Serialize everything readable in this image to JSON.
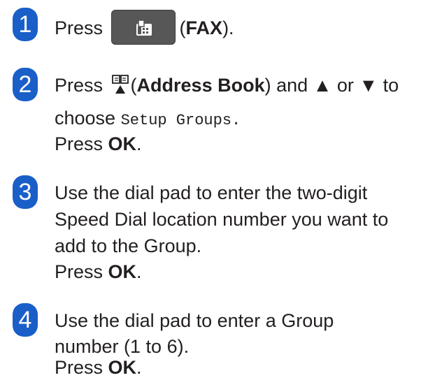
{
  "steps": [
    {
      "number": "1",
      "parts": {
        "press": "Press",
        "open_paren": "(",
        "fax_label": "FAX",
        "close_paren": ")."
      }
    },
    {
      "number": "2",
      "parts": {
        "press": "Press",
        "open_paren": "(",
        "address_book_label": "Address Book",
        "and_text": ") and ▲ or ▼ to",
        "choose": "choose",
        "setup_groups": "Setup Groups",
        "period": ".",
        "press_ok_prefix": "Press",
        "ok": "OK",
        "ok_period": "."
      }
    },
    {
      "number": "3",
      "lines": [
        "Use the dial pad to enter the two-digit",
        "Speed Dial location number you want to",
        "add to the Group."
      ],
      "press_ok_prefix": "Press",
      "ok": "OK",
      "ok_period": "."
    },
    {
      "number": "4",
      "lines": [
        "Use the dial pad to enter a Group",
        "number (1 to 6)."
      ],
      "press_ok_prefix": "Press",
      "ok": "OK",
      "ok_period": "."
    }
  ],
  "colors": {
    "badge": "#1a5fc8",
    "fax_button": "#575757",
    "text": "#231f20"
  },
  "icons": {
    "fax_button_icon": "fax-icon",
    "address_book_icon": "address-book-icon"
  }
}
